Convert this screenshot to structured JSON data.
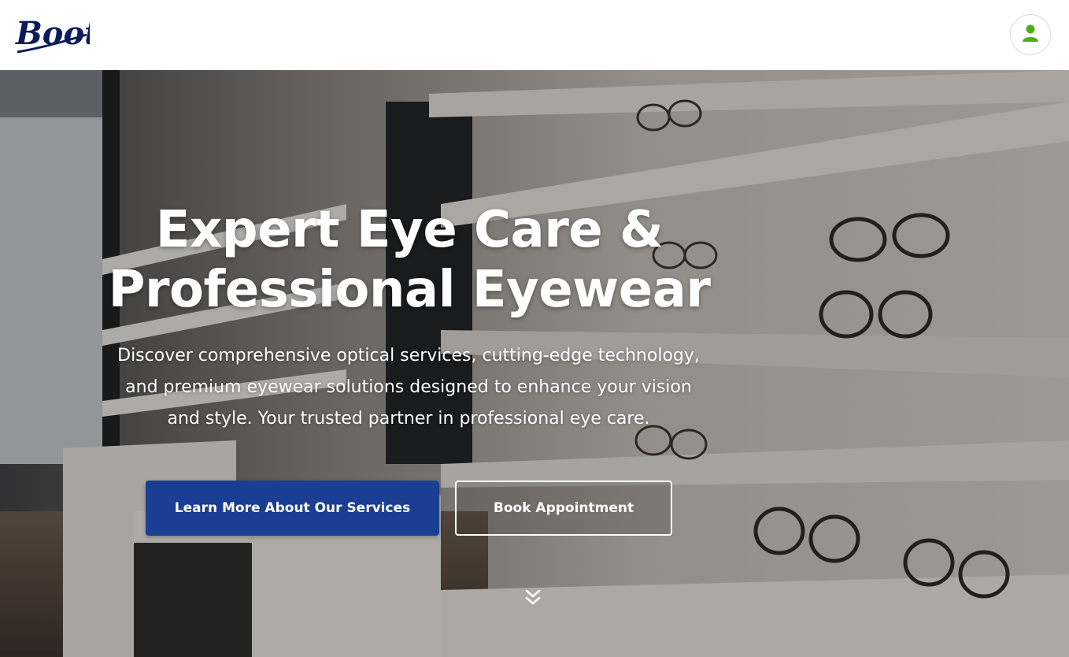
{
  "header": {
    "logo_text": "Boots",
    "account_icon": "user-icon"
  },
  "hero": {
    "title_line1": "Expert Eye Care &",
    "title_line2": "Professional Eyewear",
    "subtitle_line1": "Discover comprehensive optical services, cutting-edge technology,",
    "subtitle_line2": "and premium eyewear solutions designed to enhance your vision",
    "subtitle_line3": "and style. Your trusted partner in professional eye care.",
    "primary_button": "Learn More About Our Services",
    "secondary_button": "Book Appointment",
    "scroll_icon": "double-chevron-down-icon"
  },
  "colors": {
    "brand_navy": "#0a1a5c",
    "primary_button": "#1a3e93",
    "account_icon": "#4caf1a"
  }
}
